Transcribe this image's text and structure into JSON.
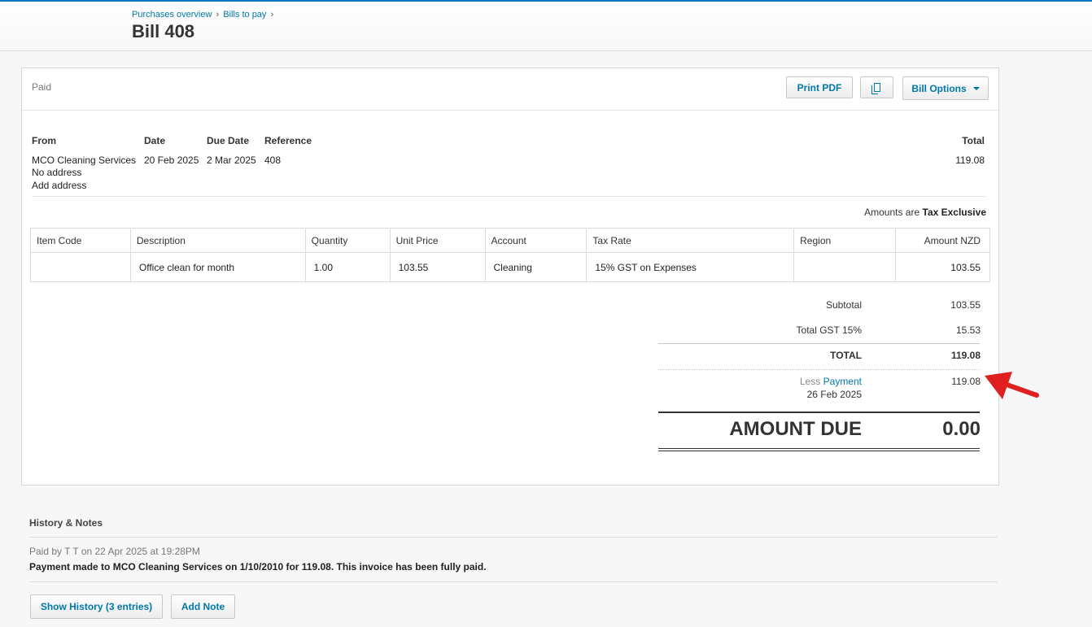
{
  "breadcrumb": {
    "item1": "Purchases overview",
    "item2": "Bills to pay",
    "sep": "›"
  },
  "page_title": "Bill 408",
  "status": "Paid",
  "toolbar": {
    "print_pdf": "Print PDF",
    "copy_icon": "copy-icon",
    "bill_options": "Bill Options"
  },
  "meta": {
    "from_label": "From",
    "date_label": "Date",
    "due_date_label": "Due Date",
    "reference_label": "Reference",
    "total_label": "Total",
    "from_value": "MCO Cleaning Services",
    "no_address": "No address",
    "add_address": "Add address",
    "date_value": "20 Feb 2025",
    "due_date_value": "2 Mar 2025",
    "reference_value": "408",
    "total_value": "119.08"
  },
  "amounts_are": {
    "prefix": "Amounts are",
    "mode": "Tax Exclusive"
  },
  "table": {
    "headers": [
      "Item Code",
      "Description",
      "Quantity",
      "Unit Price",
      "Account",
      "Tax Rate",
      "Region",
      "Amount NZD"
    ],
    "rows": [
      [
        "",
        "Office clean for month",
        "1.00",
        "103.55",
        "Cleaning",
        "15% GST on Expenses",
        "",
        "103.55"
      ]
    ]
  },
  "totals": {
    "subtotal_label": "Subtotal",
    "subtotal_value": "103.55",
    "gst_label": "Total GST  15%",
    "gst_value": "15.53",
    "total_label": "TOTAL",
    "total_value": "119.08",
    "less_label": "Less",
    "payment_link": "Payment",
    "payment_date": "26 Feb 2025",
    "payment_value": "119.08",
    "amount_due_label": "AMOUNT DUE",
    "amount_due_value": "0.00"
  },
  "history": {
    "heading": "History & Notes",
    "meta": "Paid by T T on 22 Apr 2025 at 19:28PM",
    "text": "Payment made to MCO Cleaning Services on 1/10/2010 for 119.08. This invoice has been fully paid.",
    "show_history": "Show History (3 entries)",
    "add_note": "Add Note"
  },
  "colors": {
    "accent": "#0078a8",
    "annotation_arrow": "#e02020"
  }
}
